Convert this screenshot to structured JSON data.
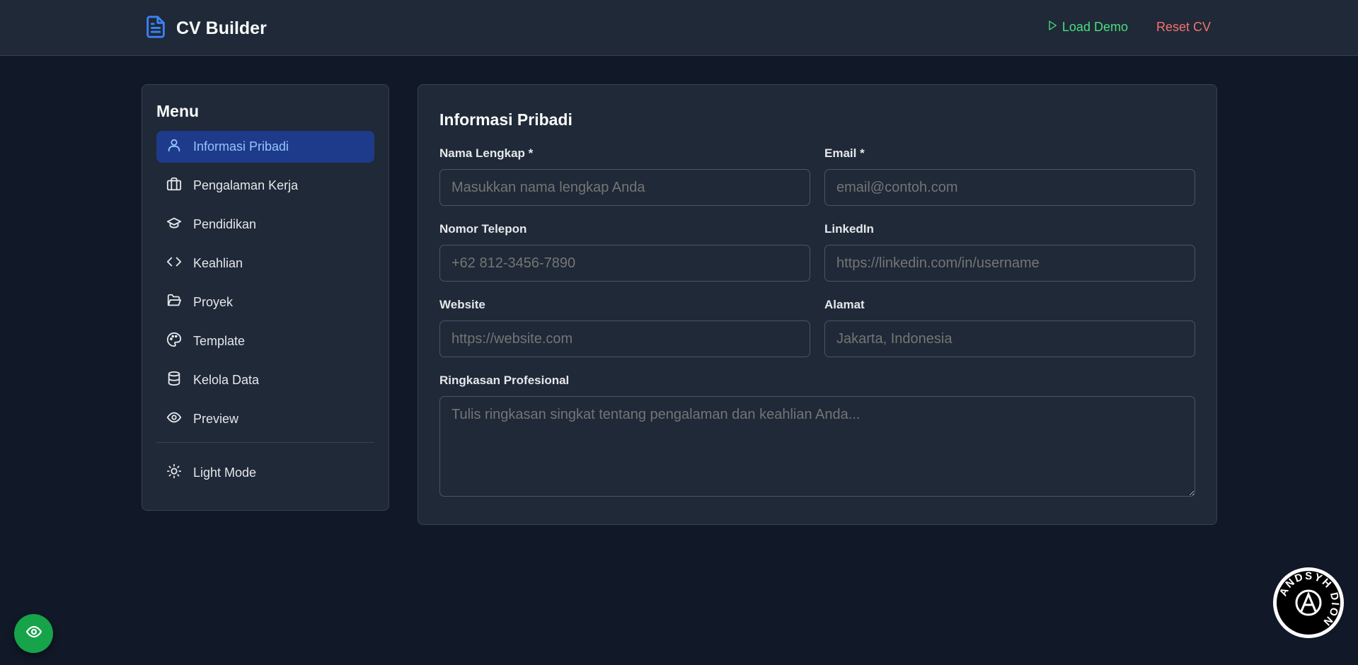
{
  "header": {
    "title": "CV Builder",
    "load_demo": "Load Demo",
    "reset": "Reset CV"
  },
  "sidebar": {
    "title": "Menu",
    "items": [
      {
        "label": "Informasi Pribadi",
        "icon": "user-icon",
        "active": true
      },
      {
        "label": "Pengalaman Kerja",
        "icon": "briefcase-icon"
      },
      {
        "label": "Pendidikan",
        "icon": "graduation-cap-icon"
      },
      {
        "label": "Keahlian",
        "icon": "code-icon"
      },
      {
        "label": "Proyek",
        "icon": "folder-open-icon"
      },
      {
        "label": "Template",
        "icon": "palette-icon"
      },
      {
        "label": "Kelola Data",
        "icon": "database-icon"
      },
      {
        "label": "Preview",
        "icon": "eye-icon"
      }
    ],
    "theme_toggle": {
      "label": "Light Mode",
      "icon": "sun-icon"
    }
  },
  "form": {
    "title": "Informasi Pribadi",
    "fields": {
      "name": {
        "label": "Nama Lengkap *",
        "placeholder": "Masukkan nama lengkap Anda",
        "value": ""
      },
      "email": {
        "label": "Email *",
        "placeholder": "email@contoh.com",
        "value": ""
      },
      "phone": {
        "label": "Nomor Telepon",
        "placeholder": "+62 812-3456-7890",
        "value": ""
      },
      "linkedin": {
        "label": "LinkedIn",
        "placeholder": "https://linkedin.com/in/username",
        "value": ""
      },
      "website": {
        "label": "Website",
        "placeholder": "https://website.com",
        "value": ""
      },
      "address": {
        "label": "Alamat",
        "placeholder": "Jakarta, Indonesia",
        "value": ""
      },
      "summary": {
        "label": "Ringkasan Profesional",
        "placeholder": "Tulis ringkasan singkat tentang pengalaman dan keahlian Anda...",
        "value": ""
      }
    }
  },
  "watermark": {
    "text": "ANDSYH DION"
  },
  "colors": {
    "background": "#111827",
    "panel": "#1f2937",
    "accent": "#3b82f6",
    "active_bg": "#1e3a8a",
    "success": "#4ade80",
    "danger": "#f87171",
    "fab": "#16a34a"
  }
}
